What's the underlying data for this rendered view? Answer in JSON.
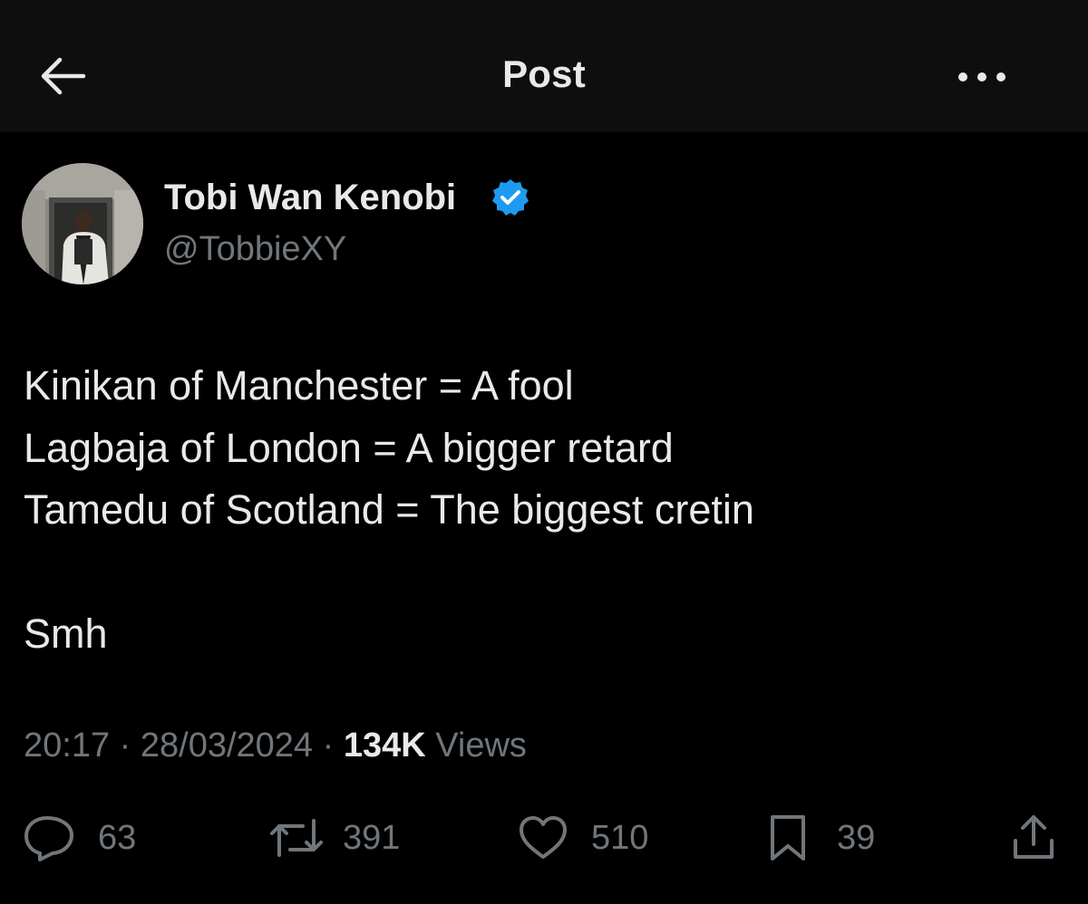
{
  "header": {
    "title": "Post",
    "back_icon": "arrow-left-icon",
    "more_icon": "more-horizontal-icon"
  },
  "author": {
    "name": "Tobi Wan Kenobi",
    "handle": "@TobbieXY",
    "verified_icon": "verified-badge-icon",
    "verified_color": "#1d9bf0"
  },
  "post": {
    "lines": [
      "Kinikan of Manchester = A fool",
      "Lagbaja of London = A bigger retard",
      "Tamedu of Scotland = The biggest cretin",
      "",
      "Smh"
    ],
    "time": "20:17",
    "date": "28/03/2024",
    "separator": "·",
    "views_count": "134K",
    "views_label": "Views"
  },
  "actions": {
    "replies": {
      "icon": "reply-icon",
      "count": "63"
    },
    "reposts": {
      "icon": "repost-icon",
      "count": "391"
    },
    "likes": {
      "icon": "heart-icon",
      "count": "510"
    },
    "bookmarks": {
      "icon": "bookmark-icon",
      "count": "39"
    },
    "share": {
      "icon": "share-icon"
    }
  },
  "colors": {
    "background": "#000000",
    "header_background": "#0e0e0e",
    "primary_text": "#e7e9ea",
    "secondary_text": "#71767b",
    "accent": "#1d9bf0"
  }
}
